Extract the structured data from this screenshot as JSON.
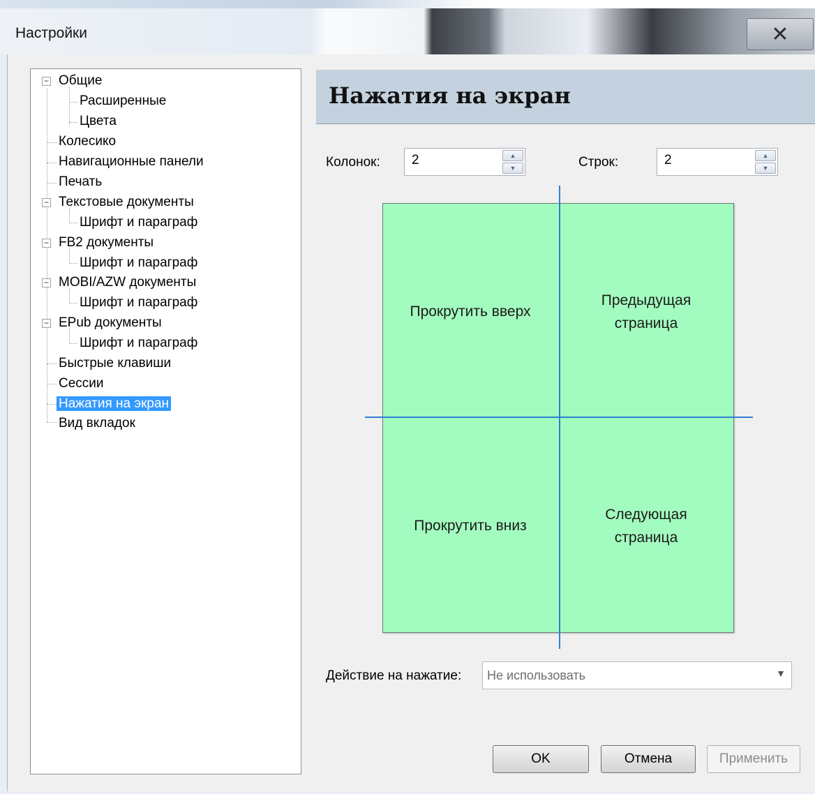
{
  "window": {
    "title": "Настройки",
    "close_glyph": "✕"
  },
  "tree": {
    "items": [
      {
        "label": "Общие",
        "expanded": true
      },
      {
        "label": "Расширенные"
      },
      {
        "label": "Цвета"
      },
      {
        "label": "Колесико"
      },
      {
        "label": "Навигационные панели"
      },
      {
        "label": "Печать"
      },
      {
        "label": "Текстовые документы",
        "expanded": true
      },
      {
        "label": "Шрифт и параграф"
      },
      {
        "label": "FB2 документы",
        "expanded": true
      },
      {
        "label": "Шрифт и параграф"
      },
      {
        "label": "MOBI/AZW документы",
        "expanded": true
      },
      {
        "label": "Шрифт и параграф"
      },
      {
        "label": "EPub документы",
        "expanded": true
      },
      {
        "label": "Шрифт и параграф"
      },
      {
        "label": "Быстрые клавиши"
      },
      {
        "label": "Сессии"
      },
      {
        "label": "Нажатия на экран",
        "selected": true
      },
      {
        "label": "Вид вкладок"
      }
    ]
  },
  "page": {
    "title": "Нажатия на экран",
    "columns_label": "Колонок:",
    "columns_value": "2",
    "rows_label": "Строк:",
    "rows_value": "2",
    "cells": {
      "top_left": "Прокрутить вверх",
      "top_right_line1": "Предыдущая",
      "top_right_line2": "страница",
      "bottom_left": "Прокрутить вниз",
      "bottom_right_line1": "Следующая",
      "bottom_right_line2": "страница"
    },
    "action_label": "Действие на нажатие:",
    "action_value": "Не использовать"
  },
  "buttons": {
    "ok": "OK",
    "cancel": "Отмена",
    "apply": "Применить"
  },
  "colors": {
    "grid_fill": "#a3fcbf",
    "grid_lines": "#2f7fd6",
    "selection": "#3399ff"
  }
}
